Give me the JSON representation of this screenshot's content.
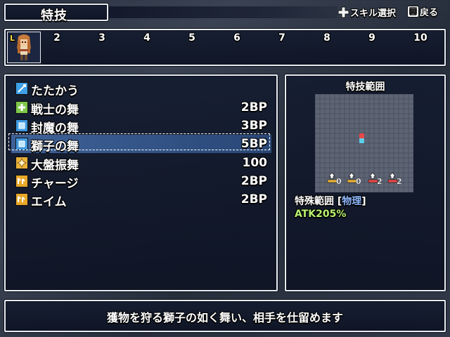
{
  "header": {
    "title": "特技",
    "hint_select": "スキル選択",
    "hint_back": "戻る",
    "back_button_glyph": "☒"
  },
  "party": {
    "active_badge": "L",
    "slots": [
      "2",
      "3",
      "4",
      "5",
      "6",
      "7",
      "8",
      "9",
      "10"
    ]
  },
  "skills": [
    {
      "name": "たたかう",
      "cost": "",
      "icon": "attack-icon",
      "color": "#3fa0e8"
    },
    {
      "name": "戦士の舞",
      "cost": "2BP",
      "icon": "plus-icon",
      "color": "#7fc74a"
    },
    {
      "name": "封魔の舞",
      "cost": "3BP",
      "icon": "square-icon",
      "color": "#3f9ae0"
    },
    {
      "name": "獅子の舞",
      "cost": "5BP",
      "icon": "square-icon",
      "color": "#3f9ae0",
      "selected": true
    },
    {
      "name": "大盤振舞",
      "cost": "100",
      "icon": "sparkle-icon",
      "color": "#e8b23a"
    },
    {
      "name": "チャージ",
      "cost": "2BP",
      "icon": "up-icon",
      "color": "#e8a82a"
    },
    {
      "name": "エイム",
      "cost": "2BP",
      "icon": "up-icon",
      "color": "#e8a82a"
    }
  ],
  "range": {
    "title": "特技範囲",
    "stat_changes": [
      "0",
      "0",
      "2",
      "2"
    ],
    "special_label": "特殊範囲",
    "attack_type": "物理",
    "atk": "ATK205%"
  },
  "description": "獲物を狩る獅子の如く舞い、相手を仕留めます",
  "colors": {
    "accent_selected": "#3e6fb0",
    "atk_green": "#b8f070",
    "type_blue": "#8fb8ff"
  }
}
